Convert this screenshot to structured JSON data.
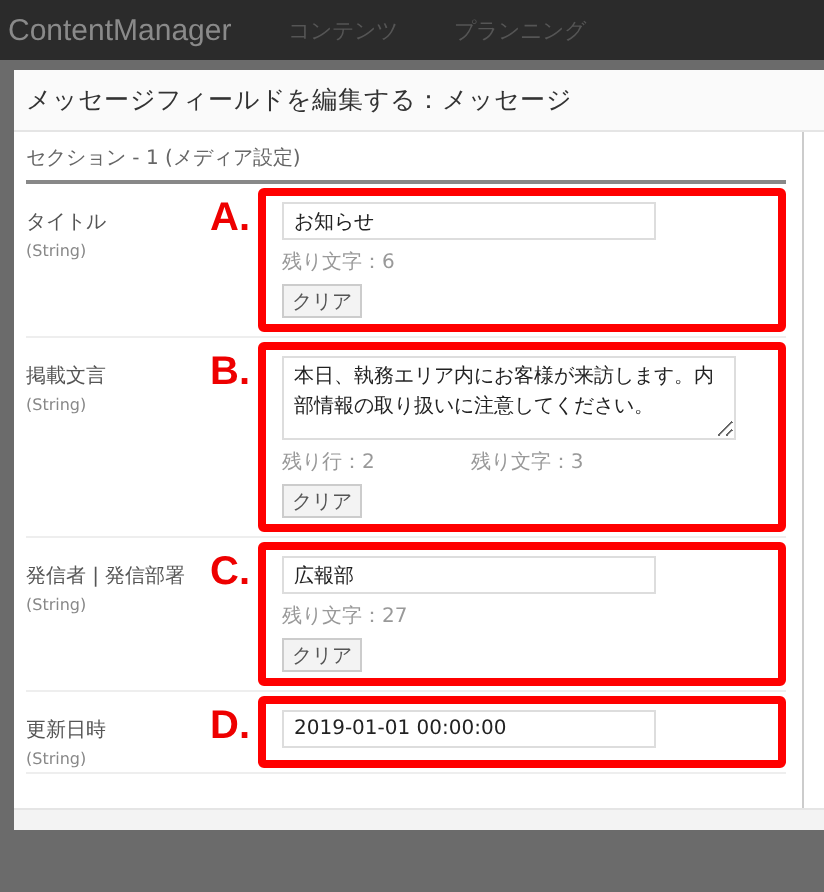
{
  "navbar": {
    "brand": "ContentManager",
    "items": [
      "コンテンツ",
      "プランニング"
    ]
  },
  "modal": {
    "title": "メッセージフィールドを編集する：メッセージ",
    "section": "セクション - 1 (メディア設定)",
    "fields": [
      {
        "label": "タイトル",
        "type": "(String)",
        "kind": "input",
        "value": "お知らせ",
        "counters": [
          "残り文字：6"
        ],
        "clear_button": "クリア",
        "annotation": "A."
      },
      {
        "label": "掲載文言",
        "type": "(String)",
        "kind": "textarea",
        "value": "本日、執務エリア内にお客様が来訪します。内部情報の取り扱いに注意してください。",
        "counters": [
          "残り行：2",
          "残り文字：3"
        ],
        "clear_button": "クリア",
        "annotation": "B."
      },
      {
        "label": "発信者 | 発信部署",
        "type": "(String)",
        "kind": "input",
        "value": "広報部",
        "counters": [
          "残り文字：27"
        ],
        "clear_button": "クリア",
        "annotation": "C."
      },
      {
        "label": "更新日時",
        "type": "(String)",
        "kind": "input",
        "value": "2019-01-01 00:00:00",
        "annotation": "D."
      }
    ]
  }
}
